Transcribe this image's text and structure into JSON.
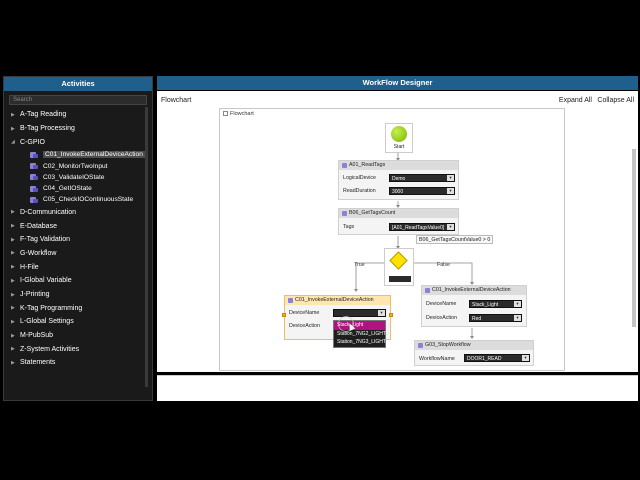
{
  "activities": {
    "title": "Activities",
    "search_placeholder": "Search",
    "groups": [
      {
        "label": "A-Tag Reading"
      },
      {
        "label": "B-Tag Processing"
      },
      {
        "label": "C-GPIO"
      },
      {
        "label": "D-Communication"
      },
      {
        "label": "E-Database"
      },
      {
        "label": "F-Tag Validation"
      },
      {
        "label": "G-Workflow"
      },
      {
        "label": "H-File"
      },
      {
        "label": "I-Global Variable"
      },
      {
        "label": "J-Printing"
      },
      {
        "label": "K-Tag Programming"
      },
      {
        "label": "L-Global Settings"
      },
      {
        "label": "M-PubSub"
      },
      {
        "label": "Z-System Activities"
      },
      {
        "label": "Statements"
      }
    ],
    "gpio_children": [
      {
        "label": "C01_InvokeExternalDeviceAction",
        "selected": true
      },
      {
        "label": "C02_MonitorTwoInput"
      },
      {
        "label": "C03_ValidateIOState"
      },
      {
        "label": "C04_GetIOState"
      },
      {
        "label": "C05_CheckIOContinuousState"
      }
    ]
  },
  "designer": {
    "title": "WorkFlow Designer",
    "breadcrumb": "Flowchart",
    "expand_all": "Expand All",
    "collapse_all": "Collapse All",
    "canvas_title": "Flowchart",
    "start_label": "Start",
    "read_tags": {
      "title": "A01_ReadTags",
      "logical_device_label": "LogicalDevice",
      "logical_device_value": "Demo",
      "read_duration_label": "ReadDuration",
      "read_duration_value": "3000"
    },
    "get_tags_count": {
      "title": "B06_GetTagsCount",
      "tags_label": "Tags",
      "tags_value": "[A01_ReadTagsValue0]"
    },
    "condition_tooltip": "B06_GetTagsCountValue0 > 0",
    "true_label": "True",
    "false_label": "False",
    "invoke_left": {
      "title": "C01_InvokeExternalDeviceAction",
      "device_name_label": "DeviceName",
      "device_name_value": "",
      "device_action_label": "DeviceAction",
      "options": [
        "Stack_Light",
        "Station_7NG2_LIGHT",
        "Station_7NG3_LIGHT"
      ]
    },
    "invoke_right": {
      "title": "C01_InvokeExternalDeviceAction",
      "device_name_label": "DeviceName",
      "device_name_value": "Stack_Light",
      "device_action_label": "DeviceAction",
      "device_action_value": "Red"
    },
    "stop_workflow": {
      "title": "G03_StopWorkflow",
      "workflow_name_label": "WorkflowName",
      "workflow_name_value": "DOOR1_READ"
    }
  },
  "colors": {
    "panel_header": "#1f5f8b",
    "start_green": "#7bb300",
    "decision_yellow": "#ffe200",
    "dropdown_highlight": "#b0137f",
    "selected_activity_title": "#fde6b0"
  }
}
